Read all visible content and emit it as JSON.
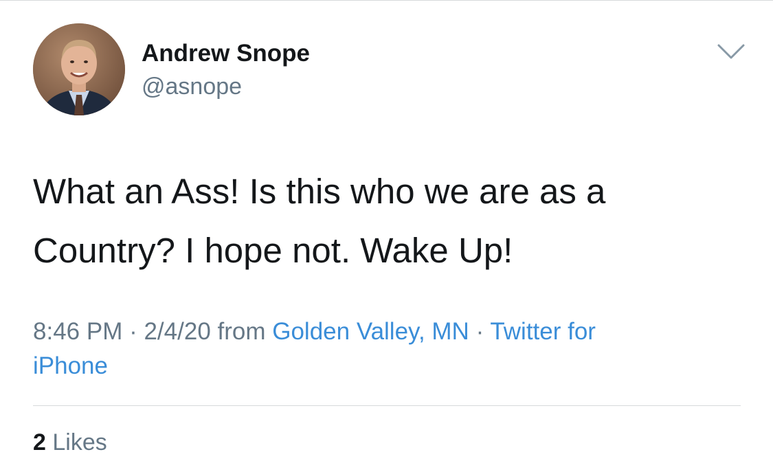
{
  "tweet": {
    "author": {
      "display_name": "Andrew Snope",
      "handle": "@asnope"
    },
    "text_line1": "What an Ass! Is this who we are as a",
    "text_line2": "Country? I hope not. Wake Up!",
    "meta": {
      "time": "8:46 PM",
      "sep1": " · ",
      "date": "2/4/20",
      "from": " from ",
      "location": "Golden Valley, MN",
      "sep2": " · ",
      "source_part1": "Twitter for",
      "source_part2": "iPhone"
    },
    "likes": {
      "count": "2",
      "label": " Likes"
    }
  },
  "icons": {
    "menu": "chevron-down-icon",
    "avatar": "avatar"
  },
  "colors": {
    "text": "#14171a",
    "secondary": "#657786",
    "link": "#3a8dd8",
    "divider": "#d6d9db"
  }
}
